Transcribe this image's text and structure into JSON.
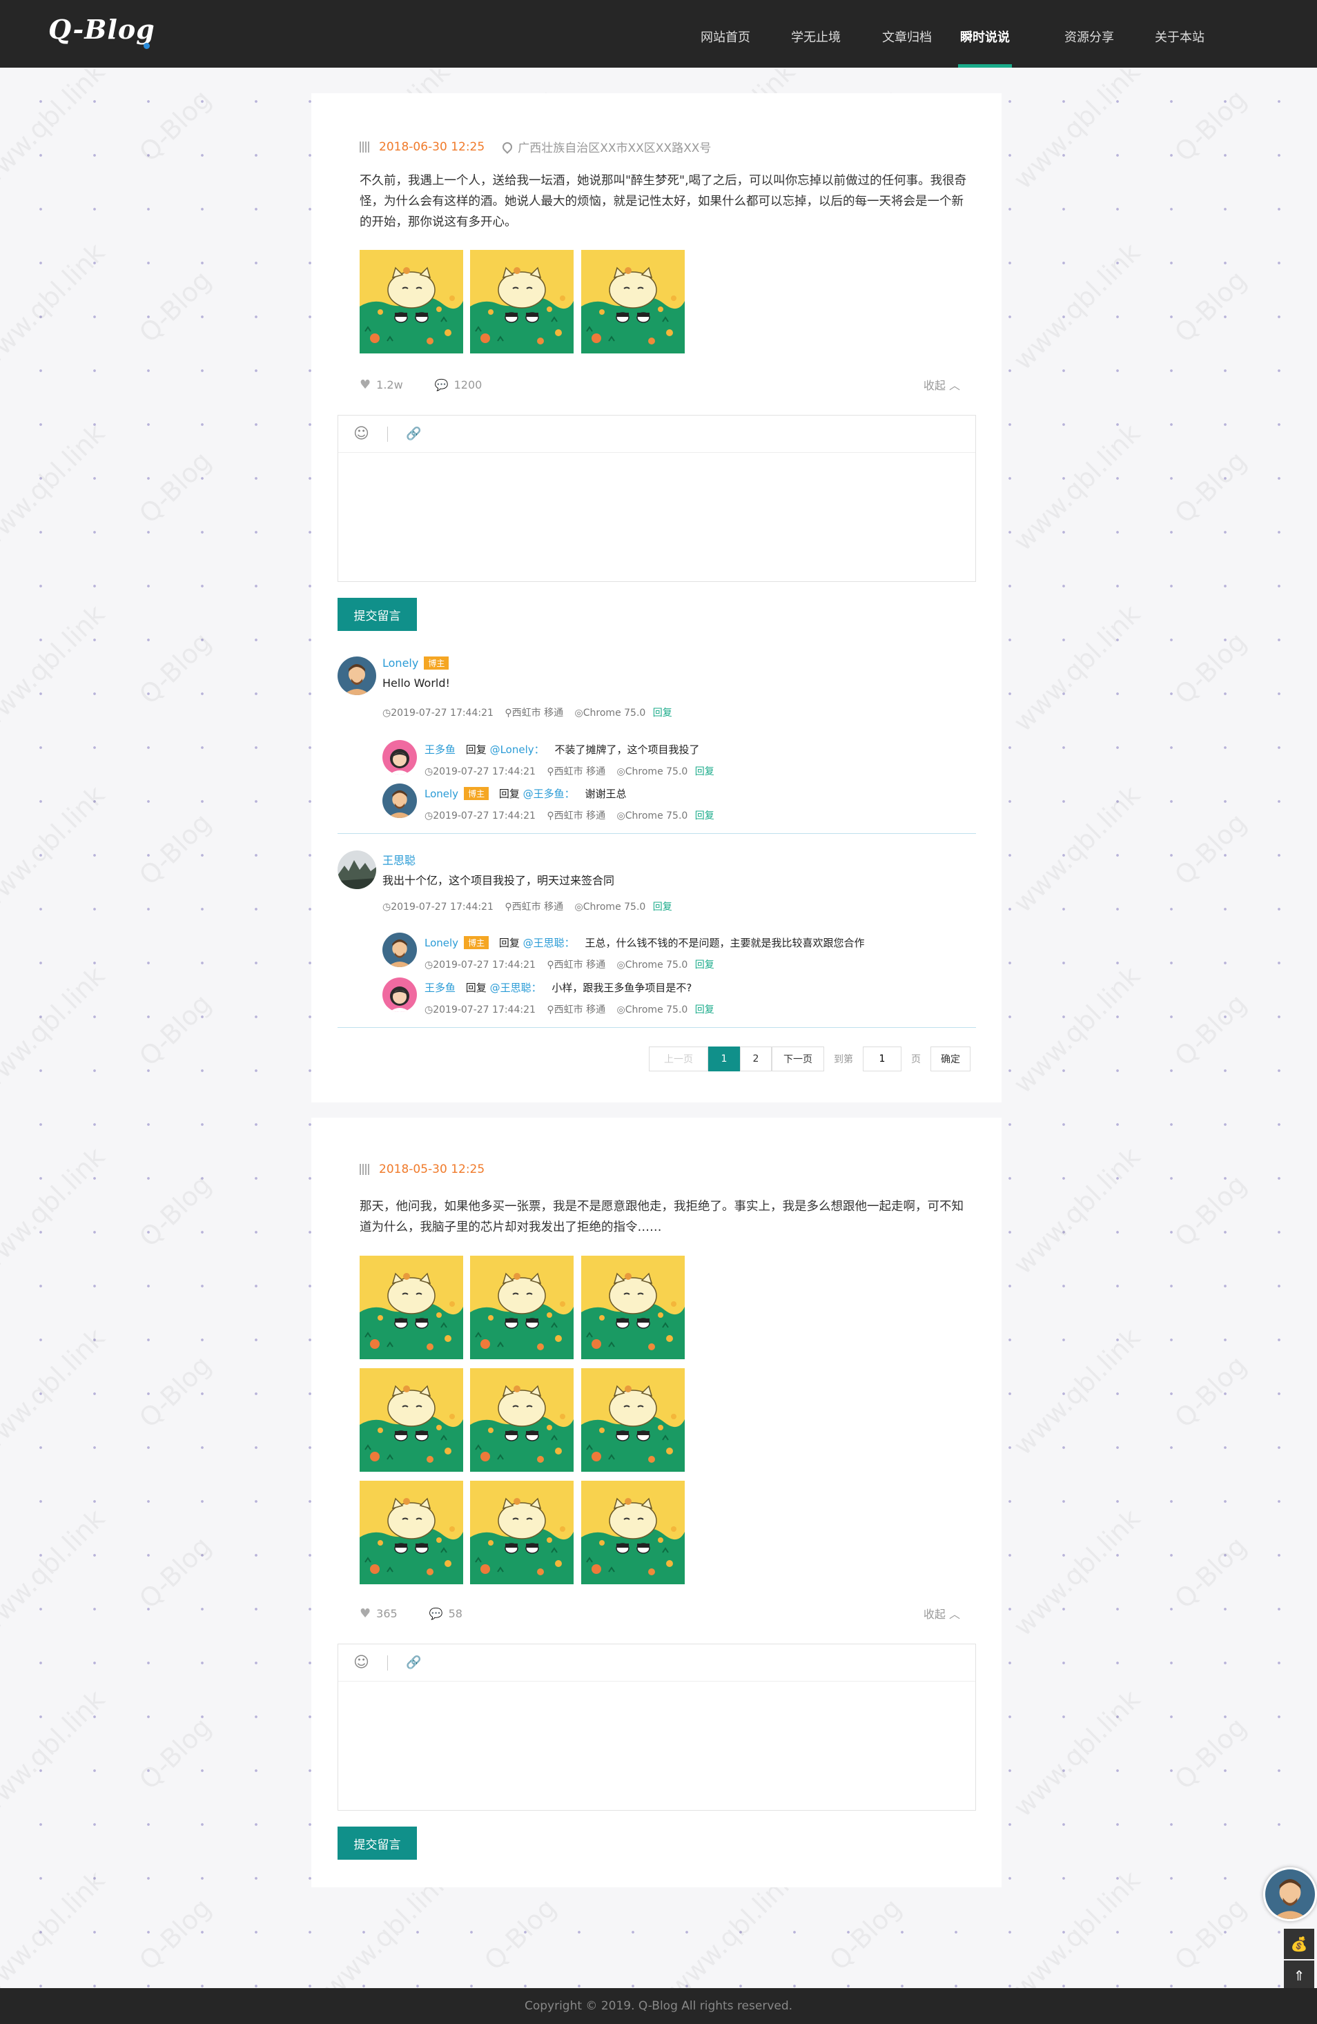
{
  "site": {
    "logo": "Q-Blog",
    "watermark": "www.qbl.link",
    "watermark2": "Q-Blog",
    "accent_color": "#10908a",
    "nav_active_color": "#1aab8a"
  },
  "nav": [
    {
      "label": "网站首页"
    },
    {
      "label": "学无止境"
    },
    {
      "label": "文章归档"
    },
    {
      "label": "瞬时说说",
      "active": true
    },
    {
      "label": "资源分享"
    },
    {
      "label": "关于本站"
    }
  ],
  "posts": [
    {
      "date": "2018-06-30 12:25",
      "location": "广西壮族自治区XX市XX区XX路XX号",
      "content": "不久前，我遇上一个人，送给我一坛酒，她说那叫\"醉生梦死\",喝了之后，可以叫你忘掉以前做过的任何事。我很奇怪，为什么会有这样的酒。她说人最大的烦恼，就是记性太好，如果什么都可以忘掉，以后的每一天将会是一个新的开始，那你说这有多开心。",
      "image_count": 3,
      "likes": "1.2w",
      "comments_count": "1200",
      "collapse_label": "收起",
      "submit_label": "提交留言",
      "comments": [
        {
          "author": "Lonely",
          "badge": "博主",
          "text": "Hello World!",
          "time": "2019-07-27 17:44:21",
          "place": "西虹市 移通",
          "browser": "Chrome 75.0",
          "reply_label": "回复",
          "replies": [
            {
              "author": "王多鱼",
              "verb": "回复",
              "target": "@Lonely：",
              "text": "不装了摊牌了，这个项目我投了",
              "time": "2019-07-27 17:44:21",
              "place": "西虹市 移通",
              "browser": "Chrome 75.0",
              "reply_label": "回复"
            },
            {
              "author": "Lonely",
              "badge": "博主",
              "verb": "回复",
              "target": "@王多鱼：",
              "text": "谢谢王总",
              "time": "2019-07-27 17:44:21",
              "place": "西虹市 移通",
              "browser": "Chrome 75.0",
              "reply_label": "回复"
            }
          ]
        },
        {
          "author": "王思聪",
          "text": "我出十个亿，这个项目我投了，明天过来签合同",
          "time": "2019-07-27 17:44:21",
          "place": "西虹市 移通",
          "browser": "Chrome 75.0",
          "reply_label": "回复",
          "replies": [
            {
              "author": "Lonely",
              "badge": "博主",
              "verb": "回复",
              "target": "@王思聪：",
              "text": "王总，什么钱不钱的不是问题，主要就是我比较喜欢跟您合作",
              "time": "2019-07-27 17:44:21",
              "place": "西虹市 移通",
              "browser": "Chrome 75.0",
              "reply_label": "回复"
            },
            {
              "author": "王多鱼",
              "verb": "回复",
              "target": "@王思聪：",
              "text": "小样，跟我王多鱼争项目是不?",
              "time": "2019-07-27 17:44:21",
              "place": "西虹市 移通",
              "browser": "Chrome 75.0",
              "reply_label": "回复"
            }
          ]
        }
      ],
      "pager": {
        "prev": "上一页",
        "pages": [
          "1",
          "2"
        ],
        "current": "1",
        "next": "下一页",
        "goto": "到第",
        "input_value": "1",
        "page_unit": "页",
        "confirm": "确定"
      }
    },
    {
      "date": "2018-05-30 12:25",
      "content": "那天，他问我，如果他多买一张票，我是不是愿意跟他走，我拒绝了。事实上，我是多么想跟他一起走啊，可不知道为什么，我脑子里的芯片却对我发出了拒绝的指令……",
      "image_count": 9,
      "likes": "365",
      "comments_count": "58",
      "collapse_label": "收起",
      "submit_label": "提交留言"
    }
  ],
  "footer": {
    "text": "Copyright © 2019. Q-Blog All rights reserved."
  }
}
